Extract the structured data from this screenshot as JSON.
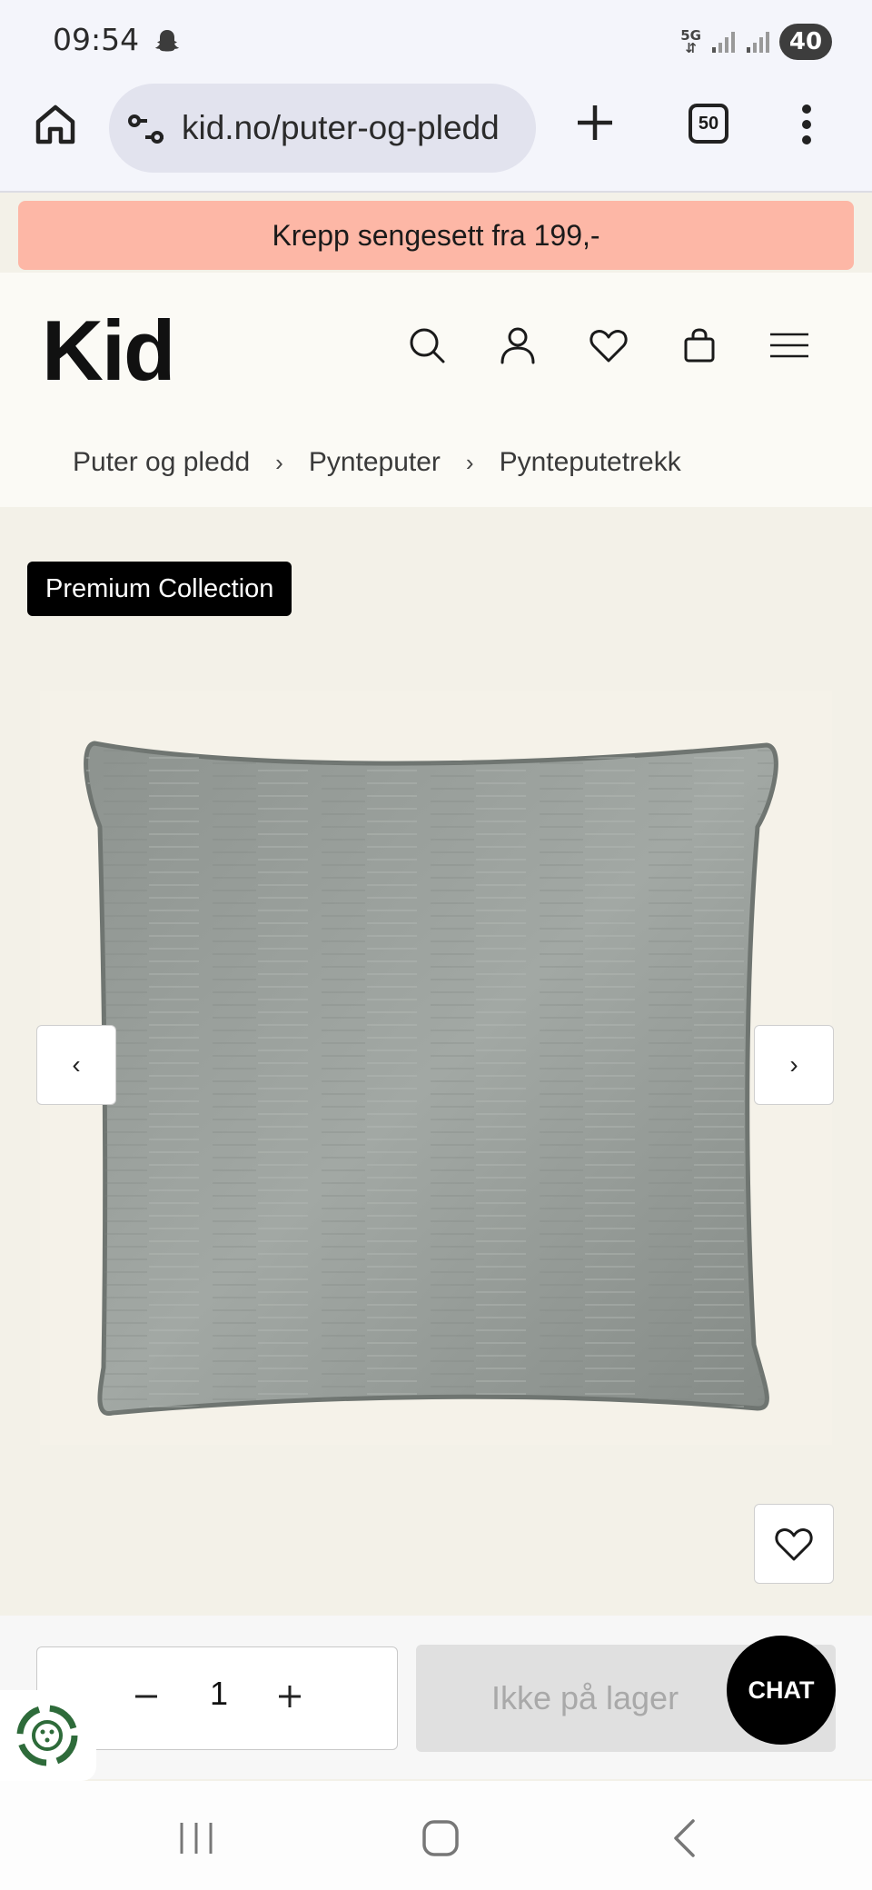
{
  "status_bar": {
    "time": "09:54",
    "network_label": "5G",
    "battery": "40",
    "icons": [
      "snapchat-ghost-icon",
      "signal-icon",
      "signal-icon"
    ]
  },
  "browser": {
    "url": "kid.no/puter-og-pledd",
    "tab_count": "50",
    "icons": [
      "home-icon",
      "site-settings-icon",
      "new-tab-plus-icon",
      "more-vert-icon"
    ]
  },
  "promo": {
    "text": "Krepp sengesett fra 199,-",
    "color": "#fdb7a6"
  },
  "header": {
    "logo": "Kid",
    "icons": [
      "search-icon",
      "account-icon",
      "wishlist-heart-icon",
      "shopping-bag-icon",
      "menu-icon"
    ]
  },
  "breadcrumb": {
    "items": [
      "Puter og pledd",
      "Pynteputer",
      "Pynteputetrekk"
    ],
    "separator": "›"
  },
  "product": {
    "badge": "Premium Collection",
    "image_icon": "gray-cushion-image",
    "prev_arrow": "‹",
    "next_arrow": "›"
  },
  "cart": {
    "quantity": "1",
    "button_label": "Ikke på lager",
    "chat_label": "CHAT"
  },
  "nav": {
    "icons": [
      "recent-apps-icon",
      "home-circle-icon",
      "back-icon"
    ]
  }
}
